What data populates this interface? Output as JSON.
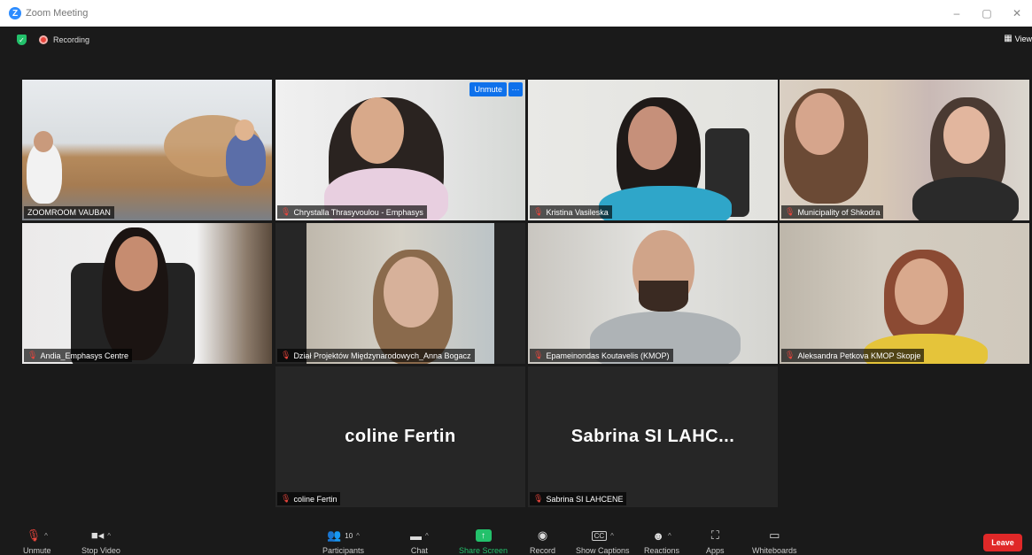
{
  "window": {
    "title": "Zoom Meeting",
    "minimize": "–",
    "restore": "▢",
    "close": "✕"
  },
  "meeting": {
    "recording_label": "Recording",
    "view_label": "View"
  },
  "tiles": [
    {
      "name": "ZOOMROOM VAUBAN",
      "muted": false
    },
    {
      "name": "Chrystalla Thrasyvoulou - Emphasys",
      "muted": true,
      "unmute_label": "Unmute",
      "more_label": "···"
    },
    {
      "name": "Kristina Vasileska",
      "muted": true
    },
    {
      "name": "Municipality of Shkodra",
      "muted": true
    },
    {
      "name": "Andia_Emphasys Centre",
      "muted": true
    },
    {
      "name": "Dział Projektów Międzynarodowych_Anna Bogacz",
      "muted": true
    },
    {
      "name": "Epameinondas Koutavelis (KMOP)",
      "muted": true
    },
    {
      "name": "Aleksandra Petkova KMOP Skopje",
      "muted": true
    },
    {
      "name": "coline Fertin",
      "display": "coline Fertin",
      "muted": true
    },
    {
      "name": "Sabrina SI LAHCENE",
      "display": "Sabrina SI LAHC...",
      "muted": true
    }
  ],
  "toolbar": {
    "unmute": "Unmute",
    "stop_video": "Stop Video",
    "participants": "Participants",
    "participants_count": "10",
    "chat": "Chat",
    "share_screen": "Share Screen",
    "record": "Record",
    "show_captions": "Show Captions",
    "cc": "CC",
    "reactions": "Reactions",
    "apps": "Apps",
    "whiteboards": "Whiteboards",
    "leave": "Leave"
  },
  "colors": {
    "accent_blue": "#0e71eb",
    "leave_red": "#e02828",
    "share_green": "#23c16b",
    "active_speaker": "#c8e06a"
  }
}
